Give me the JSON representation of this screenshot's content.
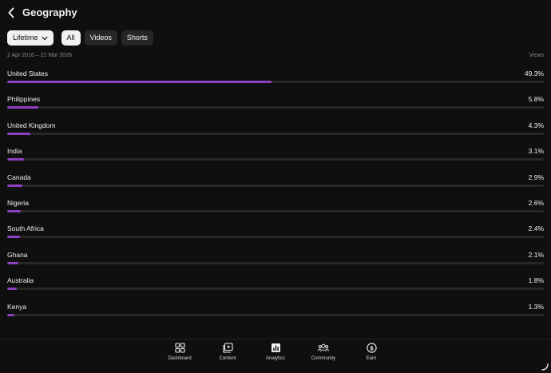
{
  "header": {
    "title": "Geography",
    "back_icon": "chevron-left-icon"
  },
  "filters": {
    "period_label": "Lifetime",
    "tabs": [
      {
        "label": "All",
        "selected": true
      },
      {
        "label": "Videos",
        "selected": false
      },
      {
        "label": "Shorts",
        "selected": false
      }
    ]
  },
  "subheader": {
    "date_range": "2 Apr 2016 – 21 Mar 2026",
    "metric": "Views"
  },
  "accent_color": "#8c3fbf",
  "countries": [
    {
      "name": "United States",
      "percent": "49.3%",
      "share": 49.3
    },
    {
      "name": "Philippines",
      "percent": "5.8%",
      "share": 5.8
    },
    {
      "name": "United Kingdom",
      "percent": "4.3%",
      "share": 4.3
    },
    {
      "name": "India",
      "percent": "3.1%",
      "share": 3.1
    },
    {
      "name": "Canada",
      "percent": "2.9%",
      "share": 2.9
    },
    {
      "name": "Nigeria",
      "percent": "2.6%",
      "share": 2.6
    },
    {
      "name": "South Africa",
      "percent": "2.4%",
      "share": 2.4
    },
    {
      "name": "Ghana",
      "percent": "2.1%",
      "share": 2.1
    },
    {
      "name": "Australia",
      "percent": "1.8%",
      "share": 1.8
    },
    {
      "name": "Kenya",
      "percent": "1.3%",
      "share": 1.3
    }
  ],
  "nav": {
    "items": [
      {
        "label": "Dashboard",
        "icon": "dashboard-icon"
      },
      {
        "label": "Content",
        "icon": "content-icon"
      },
      {
        "label": "Analytics",
        "icon": "analytics-icon"
      },
      {
        "label": "Community",
        "icon": "community-icon"
      },
      {
        "label": "Earn",
        "icon": "earn-icon"
      }
    ]
  }
}
